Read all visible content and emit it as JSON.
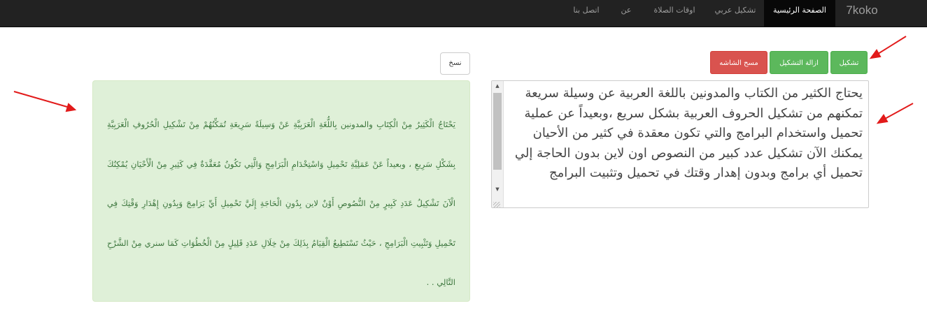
{
  "navbar": {
    "brand": "7koko",
    "items": [
      {
        "label": "الصفحة الرئيسية",
        "active": true
      },
      {
        "label": "تشكيل عربي",
        "active": false
      },
      {
        "label": "اوقات الصلاة",
        "active": false
      },
      {
        "label": "عن",
        "active": false
      },
      {
        "label": "اتصل بنا",
        "active": false
      }
    ]
  },
  "toolbar": {
    "tashkeel_label": "تشكيل",
    "remove_tashkeel_label": "ازالة التشكيل",
    "clear_label": "مسح الشاشه",
    "copy_label": "نسخ"
  },
  "source": {
    "text": "يحتاج الكثير من الكتاب والمدونين باللغة العربية عن وسيلة سريعة تمكنهم من تشكيل الحروف العربية بشكل سريع ،وبعيداً عن عملية تحميل واستخدام البرامج والتي تكون معقدة في كثير من الأحيان يمكنك الآن تشكيل عدد كبير من النصوص اون لاين بدون الحاجة إلي تحميل أي برامج وبدون إهدار وقتك في تحميل وتثبيت البرامج"
  },
  "result": {
    "text": "يَحْتَاجُ الْكَثِيرُ مِنْ الْكِتَابِ والمدونين بِاللُّغَةِ الْعَرَبِيَّةِ عَنْ وَسِيلَةً سَرِيعَةِ تُمَكِّنُهُمْ مِنْ تَشْكِيلِ الْحُرُوفِ الْعَرَبِيَّةِ بِشَكْلِ سَرِيعِ ، وبعيداً عَنْ عَمَلِيَّةِ تَحْمِيلِ وَاسْتِخْدَامِ الْبَرَامِجِ وَالَّتِي تَكُونُ مُعَقَّدَةٌ فِي كَثِيرِ مِنْ الْأَحْيَانِ يُمْكِنُكَ الْآنَ تَشْكِيلُ عَدَدِ كَبِيرٍ مِنْ النُّصُوصِ أَوْنٌ لاين بِدُونِ الْحَاجَةِ إِلَيَّ تَحْمِيلِ أَيِّ بَرَامِجَ وَبِدُونِ إِهْدَارِ وَقْتِكَ فِي تَحْمِيلِ وَتَثْبِيتِ الْبَرَامِجِ ، حَيْثُ تَسْتَطِيعُ الْقِيَامُ بِذَلِكَ مِنْ خِلَالِ عَدَدِ قَلِيلٍ مِنْ الْخُطُوَاتِ كَمَا سنري مِنْ الشَّرْحِ التَّالِي . ."
  },
  "colors": {
    "navbar_bg": "#222222",
    "success": "#5cb85c",
    "danger": "#d9534f",
    "result_bg": "#dff0d8",
    "result_text": "#3c763d",
    "annotation_arrow": "#e21b1b"
  }
}
